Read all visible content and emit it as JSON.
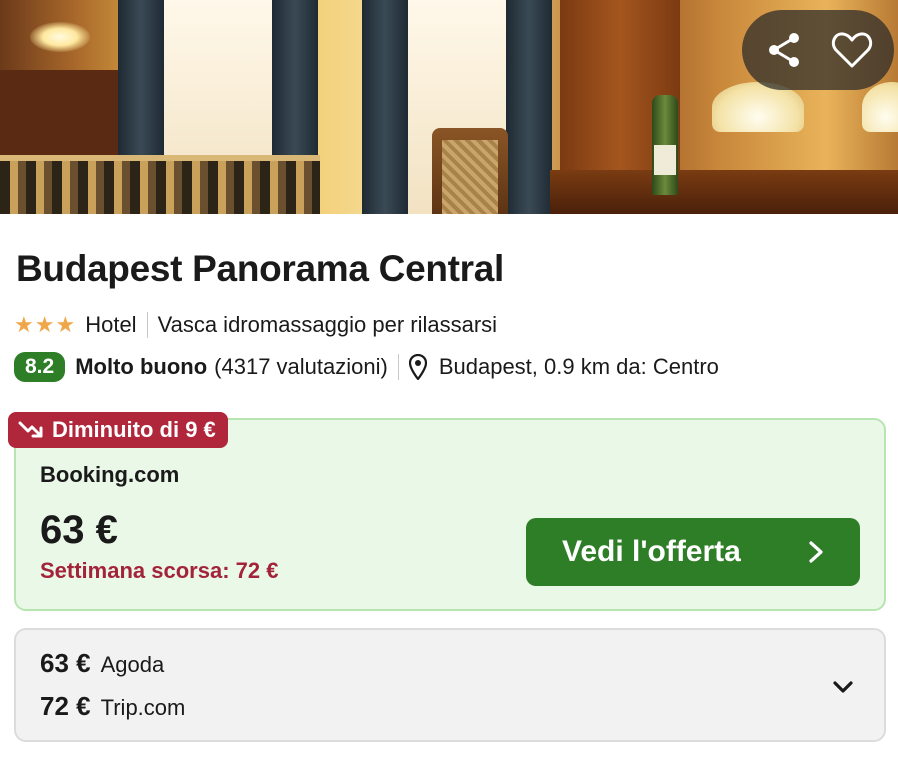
{
  "hotel": {
    "name": "Budapest Panorama Central",
    "stars": 3,
    "type": "Hotel",
    "feature": "Vasca idromassaggio per rilassarsi",
    "score": "8.2",
    "rating_word": "Molto buono",
    "reviews": "(4317 valutazioni)",
    "location": "Budapest, 0.9 km da: Centro"
  },
  "hero": {
    "share_icon": "share-icon",
    "favorite_icon": "heart-icon"
  },
  "offer": {
    "badge": "Diminuito di 9 €",
    "badge_icon": "trend-down-icon",
    "provider": "Booking.com",
    "price": "63 €",
    "last_week": "Settimana scorsa: 72 €",
    "cta_label": "Vedi l'offerta"
  },
  "other_offers": [
    {
      "price": "63 €",
      "provider": "Agoda"
    },
    {
      "price": "72 €",
      "provider": "Trip.com"
    }
  ],
  "colors": {
    "accent_green": "#2e7d27",
    "badge_red": "#b0263a",
    "star": "#f0a74a",
    "offer_bg": "#eaf8e8"
  }
}
